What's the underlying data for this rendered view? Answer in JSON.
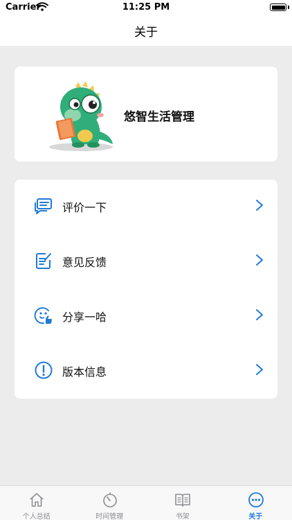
{
  "status_bar": {
    "carrier": "Carrier",
    "time": "11:25 PM"
  },
  "nav": {
    "title": "关于"
  },
  "header": {
    "app_name": "悠智生活管理"
  },
  "menu": {
    "items": [
      {
        "label": "评价一下",
        "icon": "comment-icon"
      },
      {
        "label": "意见反馈",
        "icon": "feedback-icon"
      },
      {
        "label": "分享一哈",
        "icon": "share-icon"
      },
      {
        "label": "版本信息",
        "icon": "info-icon"
      }
    ]
  },
  "tabbar": {
    "items": [
      {
        "label": "个人总结",
        "icon": "home-icon"
      },
      {
        "label": "时间管理",
        "icon": "timer-icon"
      },
      {
        "label": "书架",
        "icon": "book-icon"
      },
      {
        "label": "关于",
        "icon": "more-icon",
        "active": true
      }
    ]
  },
  "colors": {
    "accent": "#1f7ad6",
    "background": "#ececec",
    "mascot_green": "#2fae7a"
  }
}
